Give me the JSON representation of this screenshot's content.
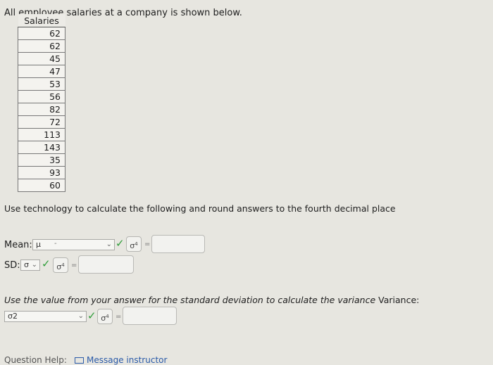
{
  "intro": "All employee salaries at a company is shown below.",
  "table": {
    "header": "Salaries",
    "values": [
      "62",
      "62",
      "45",
      "47",
      "53",
      "56",
      "82",
      "72",
      "113",
      "143",
      "35",
      "93",
      "60"
    ]
  },
  "instruction": "Use technology to calculate the following and round answers to the fourth decimal place",
  "mean": {
    "label": "Mean:",
    "selected": "μ",
    "placeholder_dash": "-",
    "symbol": "σ",
    "symbol_sup": "4",
    "equals": "=",
    "answer": ""
  },
  "sd": {
    "label": "SD:",
    "selected": "σ",
    "symbol": "σ",
    "symbol_sup": "4",
    "equals": "=",
    "answer": ""
  },
  "variance": {
    "prompt_italic": "Use the value from your answer for the standard deviation to calculate the variance",
    "prompt_label": "Variance:",
    "selected": "σ2",
    "symbol": "σ",
    "symbol_sup": "4",
    "equals": "=",
    "answer": ""
  },
  "footer": {
    "question_help": "Question Help:",
    "message_instructor": "Message instructor"
  },
  "icons": {
    "chevron": "chevron-down-icon",
    "check": "check-icon",
    "mail": "mail-icon"
  }
}
